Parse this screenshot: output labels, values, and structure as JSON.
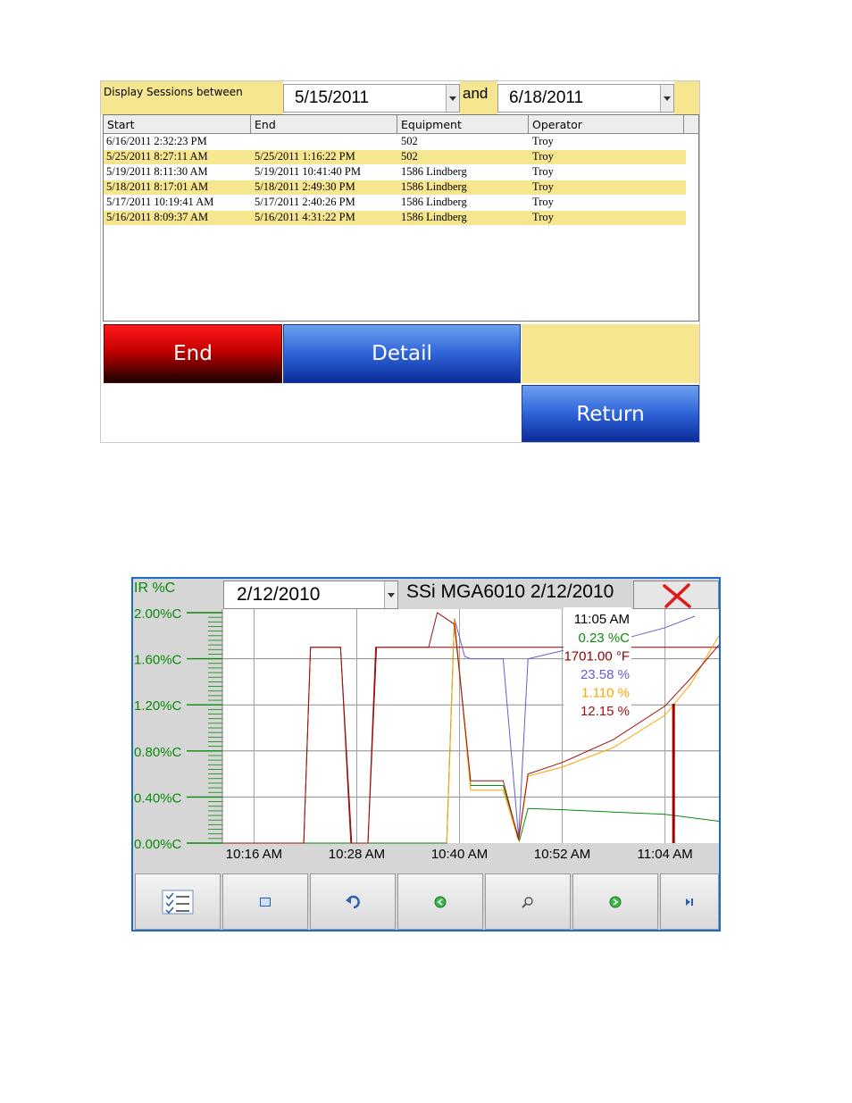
{
  "sessions_panel": {
    "filter_label": "Display Sessions between",
    "from_date": "5/15/2011",
    "and_label": "and",
    "to_date": "6/18/2011",
    "columns": [
      "Start",
      "End",
      "Equipment",
      "Operator"
    ],
    "rows": [
      {
        "start": "6/16/2011 2:32:23 PM",
        "end": "",
        "equipment": "502",
        "operator": "Troy"
      },
      {
        "start": "5/25/2011 8:27:11 AM",
        "end": "5/25/2011 1:16:22 PM",
        "equipment": "502",
        "operator": "Troy"
      },
      {
        "start": "5/19/2011 8:11:30 AM",
        "end": "5/19/2011 10:41:40 PM",
        "equipment": "1586 Lindberg",
        "operator": "Troy"
      },
      {
        "start": "5/18/2011 8:17:01 AM",
        "end": "5/18/2011 2:49:30 PM",
        "equipment": "1586 Lindberg",
        "operator": "Troy"
      },
      {
        "start": "5/17/2011 10:19:41 AM",
        "end": "5/17/2011 2:40:26 PM",
        "equipment": "1586 Lindberg",
        "operator": "Troy"
      },
      {
        "start": "5/16/2011 8:09:37 AM",
        "end": "5/16/2011 4:31:22 PM",
        "equipment": "1586 Lindberg",
        "operator": "Troy"
      }
    ],
    "buttons": {
      "end": "End",
      "detail": "Detail",
      "return": "Return"
    },
    "colors": {
      "row_highlight": "#f5e68f",
      "end_button": "#c40000",
      "blue_button": "#2f64d8"
    }
  },
  "chart_panel": {
    "y_axis_title": "IR %C",
    "date_value": "2/12/2010",
    "title": "SSi MGA6010 2/12/2010",
    "close_icon": "red-x-icon",
    "cursor_readout": {
      "time": "11:05 AM",
      "values": [
        {
          "text": "0.23 %C",
          "color": "#0a8a0a"
        },
        {
          "text": "1701.00 °F",
          "color": "#8b0000"
        },
        {
          "text": "23.58 %",
          "color": "#6a5acd"
        },
        {
          "text": "1.110 %",
          "color": "#ffa500"
        },
        {
          "text": "12.15 %",
          "color": "#a01010"
        }
      ]
    },
    "toolbar": [
      {
        "icon": "checklist-icon"
      },
      {
        "icon": "window-icon"
      },
      {
        "icon": "undo-icon"
      },
      {
        "icon": "back-icon"
      },
      {
        "icon": "zoom-icon"
      },
      {
        "icon": "forward-icon"
      },
      {
        "icon": "end-icon"
      }
    ]
  },
  "chart_data": {
    "type": "line",
    "title": "SSi MGA6010 2/12/2010",
    "ylabel": "IR %C",
    "xlabel": "",
    "y_ticks": [
      "0.00%C",
      "0.40%C",
      "0.80%C",
      "1.20%C",
      "1.60%C",
      "2.00%C"
    ],
    "ylim": [
      0,
      2.0
    ],
    "x_ticks": [
      "10:16 AM",
      "10:28 AM",
      "10:40 AM",
      "10:52 AM",
      "11:04 AM"
    ],
    "x_tick_minutes": [
      616,
      628,
      640,
      652,
      664
    ],
    "xlim": [
      612.3,
      670.3
    ],
    "grid": true,
    "cursor_minute": 665,
    "series": [
      {
        "color": "#0a8a0a",
        "points": [
          [
            612.3,
            0
          ],
          [
            638.5,
            0
          ],
          [
            639.4,
            1.95
          ],
          [
            641.3,
            0.5
          ],
          [
            645.1,
            0.5
          ],
          [
            647.0,
            0.02
          ],
          [
            648.0,
            0.3
          ],
          [
            652,
            0.29
          ],
          [
            658,
            0.27
          ],
          [
            664,
            0.25
          ],
          [
            670.3,
            0.19
          ]
        ]
      },
      {
        "color": "#8b0000",
        "points": [
          [
            612.3,
            0
          ],
          [
            621.8,
            0
          ],
          [
            622.6,
            1.7
          ],
          [
            626.1,
            1.7
          ],
          [
            627.4,
            0
          ],
          [
            629.3,
            0
          ],
          [
            630.3,
            1.7
          ],
          [
            636.4,
            1.7
          ],
          [
            637.4,
            1.7
          ],
          [
            639.4,
            1.7
          ],
          [
            645.1,
            1.7
          ],
          [
            646.1,
            1.7
          ],
          [
            670.3,
            1.7
          ]
        ]
      },
      {
        "color": "#6a5acd",
        "points": [
          [
            639.4,
            1.95
          ],
          [
            640.6,
            1.62
          ],
          [
            641.3,
            1.6
          ],
          [
            645.1,
            1.6
          ],
          [
            646.9,
            0.05
          ],
          [
            648.0,
            1.6
          ],
          [
            652,
            1.67
          ],
          [
            658,
            1.75
          ],
          [
            664,
            1.87
          ],
          [
            667.5,
            1.97
          ]
        ]
      },
      {
        "color": "#ffa500",
        "points": [
          [
            638.5,
            0
          ],
          [
            639.4,
            1.95
          ],
          [
            641.3,
            0.46
          ],
          [
            645.1,
            0.46
          ],
          [
            646.9,
            0.02
          ],
          [
            648.0,
            0.58
          ],
          [
            652,
            0.66
          ],
          [
            658,
            0.83
          ],
          [
            664,
            1.11
          ],
          [
            667,
            1.38
          ],
          [
            670.3,
            1.8
          ]
        ]
      },
      {
        "color": "#a01010",
        "points": [
          [
            612.3,
            0
          ],
          [
            621.8,
            0
          ],
          [
            622.6,
            1.7
          ],
          [
            626.1,
            1.7
          ],
          [
            627.3,
            0
          ],
          [
            629.3,
            0
          ],
          [
            630.2,
            1.7
          ],
          [
            636.4,
            1.7
          ],
          [
            637.4,
            2.0
          ],
          [
            639.4,
            1.9
          ],
          [
            641.3,
            0.54
          ],
          [
            645.1,
            0.54
          ],
          [
            646.9,
            0.03
          ],
          [
            648.0,
            0.6
          ],
          [
            652,
            0.7
          ],
          [
            658,
            0.9
          ],
          [
            664,
            1.19
          ],
          [
            667,
            1.43
          ],
          [
            670.3,
            1.72
          ]
        ]
      }
    ]
  }
}
